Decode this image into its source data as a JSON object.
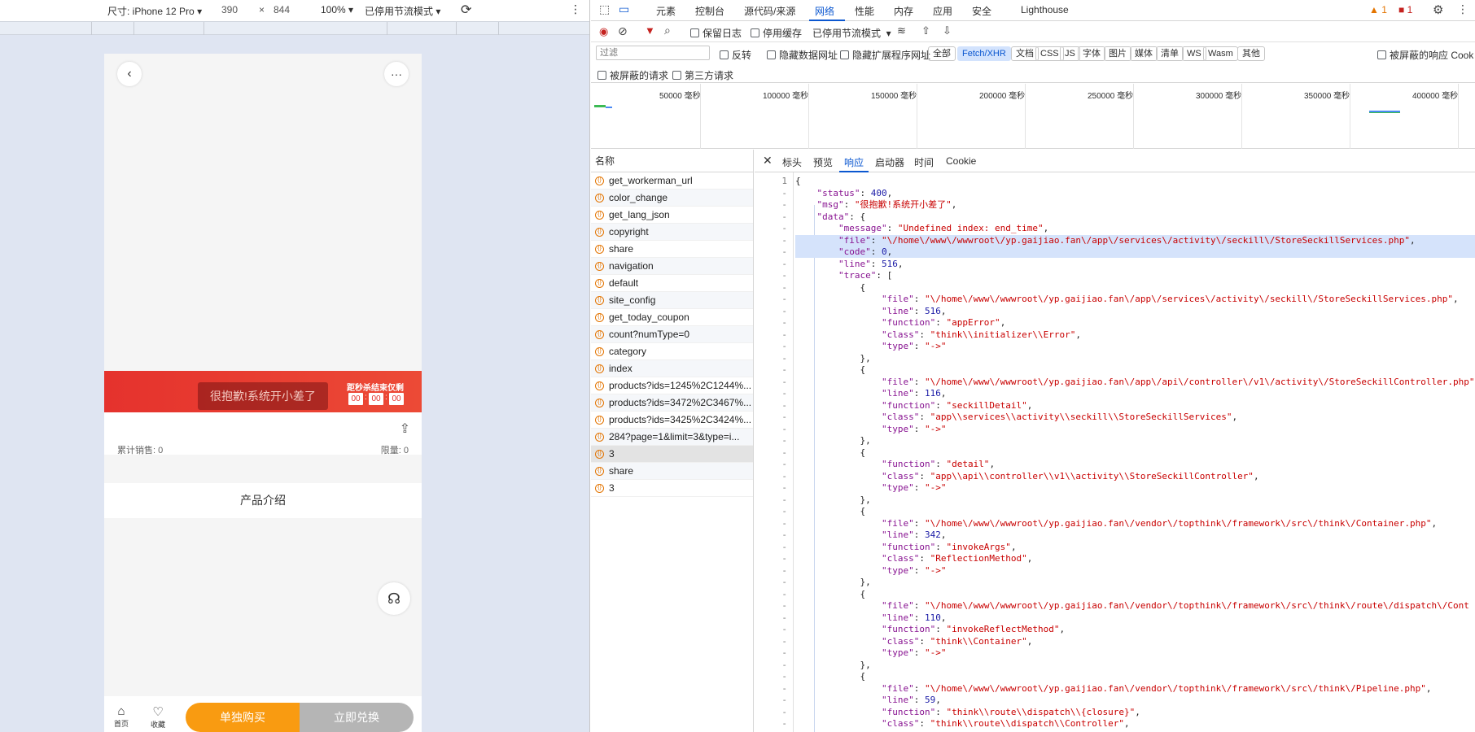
{
  "emulator": {
    "size_label": "尺寸: iPhone 12 Pro",
    "width": "390",
    "times": "×",
    "height": "844",
    "zoom": "100%",
    "throttle": "已停用节流模式"
  },
  "phone": {
    "toast": "很抱歉!系统开小差了",
    "countdown_label": "距秒杀结束仅剩",
    "countdown": [
      "00",
      "00",
      "00"
    ],
    "sales": "累计销售: 0",
    "limit": "限量: 0",
    "intro": "产品介绍",
    "nav_home": "首页",
    "nav_fav": "收藏",
    "buy_button": "单独购买",
    "exchange_button": "立即兑换",
    "colors": {
      "banner": "#e5322d",
      "buy": "#f99b11",
      "exchange": "#b5b5b5"
    }
  },
  "devtools": {
    "tabs": [
      "元素",
      "控制台",
      "源代码/来源",
      "网络",
      "性能",
      "内存",
      "应用",
      "安全",
      "Lighthouse"
    ],
    "active_tab": "网络",
    "warn_count": "1",
    "issue_count": "1",
    "toolbar": {
      "preserve_log": "保留日志",
      "disable_cache": "停用缓存",
      "throttle": "已停用节流模式"
    },
    "filter": {
      "placeholder": "过滤",
      "invert": "反转",
      "hide_data_urls": "隐藏数据网址",
      "hide_ext_urls": "隐藏扩展程序网址",
      "types": [
        "全部",
        "Fetch/XHR",
        "文档",
        "CSS",
        "JS",
        "字体",
        "图片",
        "媒体",
        "清单",
        "WS",
        "Wasm",
        "其他"
      ],
      "active_type": "Fetch/XHR",
      "blocked_cookies": "被屏蔽的响应 Cookie",
      "blocked_requests": "被屏蔽的请求",
      "third_party": "第三方请求"
    },
    "timeline_ticks": [
      "50000 毫秒",
      "100000 毫秒",
      "150000 毫秒",
      "200000 毫秒",
      "250000 毫秒",
      "300000 毫秒",
      "350000 毫秒",
      "400000 毫秒"
    ],
    "name_header": "名称",
    "requests": [
      "get_workerman_url",
      "color_change",
      "get_lang_json",
      "copyright",
      "share",
      "navigation",
      "default",
      "site_config",
      "get_today_coupon",
      "count?numType=0",
      "category",
      "index",
      "products?ids=1245%2C1244%...",
      "products?ids=3472%2C3467%...",
      "products?ids=3425%2C3424%...",
      "284?page=1&limit=3&type=i...",
      "3",
      "share",
      "3"
    ],
    "selected_request_index": 16,
    "detail_tabs": [
      "标头",
      "预览",
      "响应",
      "启动器",
      "时间",
      "Cookie"
    ],
    "active_detail_tab": "响应",
    "response_lines": [
      "{",
      "    \"status\": 400,",
      "    \"msg\": \"很抱歉!系统开小差了\",",
      "    \"data\": {",
      "        \"message\": \"Undefined index: end_time\",",
      "        \"file\": \"\\/home\\/www\\/wwwroot\\/yp.gaijiao.fan\\/app\\/services\\/activity\\/seckill\\/StoreSeckillServices.php\",",
      "        \"code\": 0,",
      "        \"line\": 516,",
      "        \"trace\": [",
      "            {",
      "                \"file\": \"\\/home\\/www\\/wwwroot\\/yp.gaijiao.fan\\/app\\/services\\/activity\\/seckill\\/StoreSeckillServices.php\",",
      "                \"line\": 516,",
      "                \"function\": \"appError\",",
      "                \"class\": \"think\\\\initializer\\\\Error\",",
      "                \"type\": \"->\"",
      "            },",
      "            {",
      "                \"file\": \"\\/home\\/www\\/wwwroot\\/yp.gaijiao.fan\\/app\\/api\\/controller\\/v1\\/activity\\/StoreSeckillController.php\",",
      "                \"line\": 116,",
      "                \"function\": \"seckillDetail\",",
      "                \"class\": \"app\\\\services\\\\activity\\\\seckill\\\\StoreSeckillServices\",",
      "                \"type\": \"->\"",
      "            },",
      "            {",
      "                \"function\": \"detail\",",
      "                \"class\": \"app\\\\api\\\\controller\\\\v1\\\\activity\\\\StoreSeckillController\",",
      "                \"type\": \"->\"",
      "            },",
      "            {",
      "                \"file\": \"\\/home\\/www\\/wwwroot\\/yp.gaijiao.fan\\/vendor\\/topthink\\/framework\\/src\\/think\\/Container.php\",",
      "                \"line\": 342,",
      "                \"function\": \"invokeArgs\",",
      "                \"class\": \"ReflectionMethod\",",
      "                \"type\": \"->\"",
      "            },",
      "            {",
      "                \"file\": \"\\/home\\/www\\/wwwroot\\/yp.gaijiao.fan\\/vendor\\/topthink\\/framework\\/src\\/think\\/route\\/dispatch\\/Cont",
      "                \"line\": 110,",
      "                \"function\": \"invokeReflectMethod\",",
      "                \"class\": \"think\\\\Container\",",
      "                \"type\": \"->\"",
      "            },",
      "            {",
      "                \"file\": \"\\/home\\/www\\/wwwroot\\/yp.gaijiao.fan\\/vendor\\/topthink\\/framework\\/src\\/think\\/Pipeline.php\",",
      "                \"line\": 59,",
      "                \"function\": \"think\\\\route\\\\dispatch\\\\{closure}\",",
      "                \"class\": \"think\\\\route\\\\dispatch\\\\Controller\","
    ],
    "line_numbers": [
      "1",
      "-",
      "-",
      "-",
      "-",
      "-",
      "-",
      "-",
      "-",
      "-",
      "-",
      "-",
      "-",
      "-",
      "-",
      "-",
      "-",
      "-",
      "-",
      "-",
      "-",
      "-",
      "-",
      "-",
      "-",
      "-",
      "-",
      "-",
      "-",
      "-",
      "-",
      "-",
      "-",
      "-",
      "-",
      "-",
      "-",
      "-",
      "-",
      "-",
      "-",
      "-",
      "-",
      "-",
      "-",
      "-",
      "-"
    ],
    "highlighted_lines": [
      5,
      6
    ]
  }
}
